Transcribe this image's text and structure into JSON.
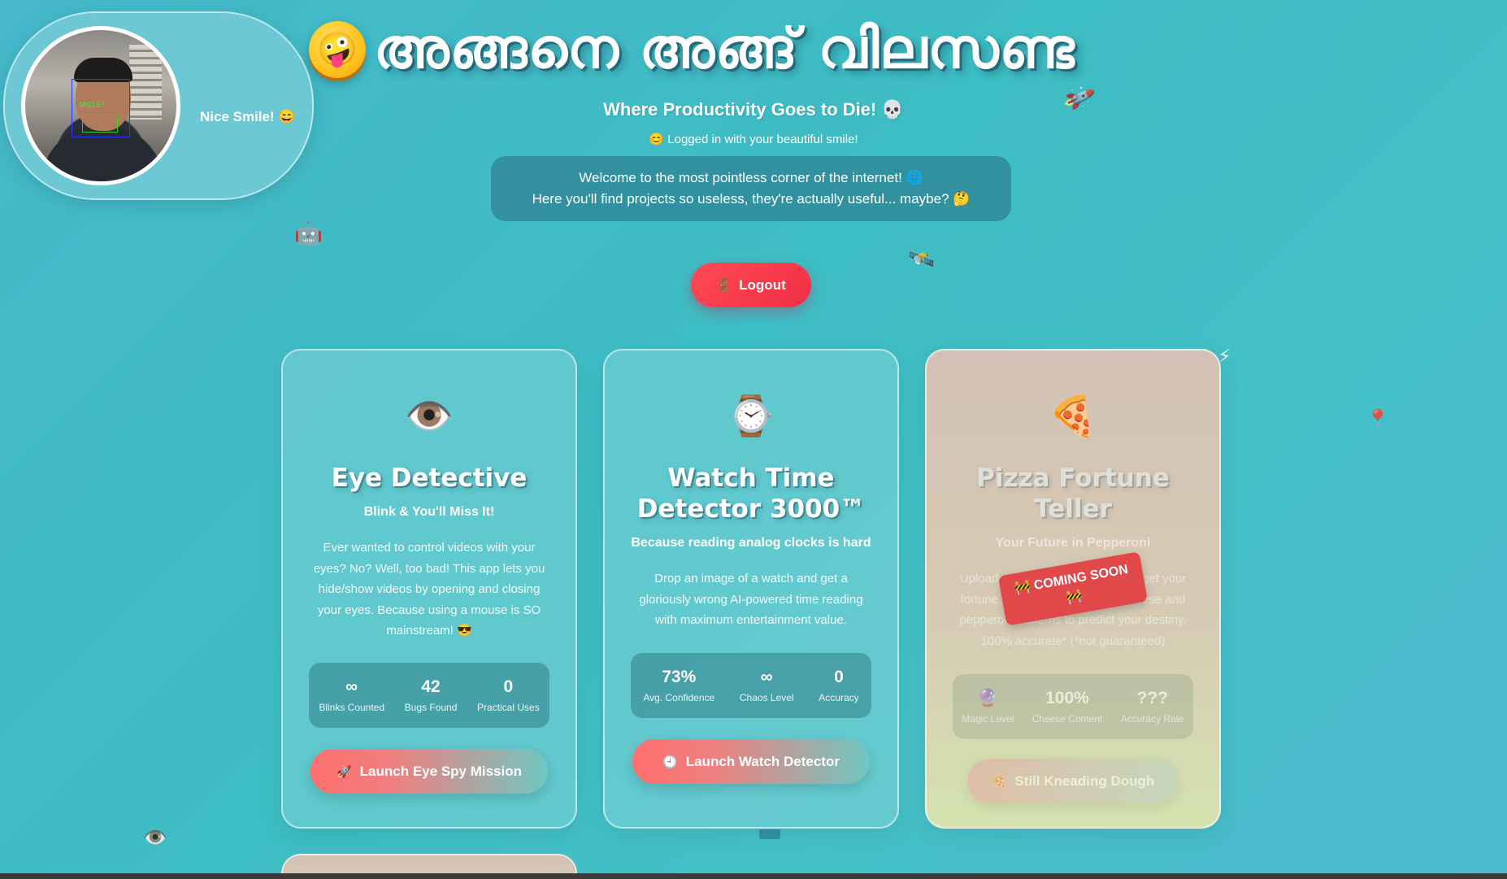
{
  "webcam": {
    "status_text": "Nice Smile! 😄",
    "overlay_label": "SMILE!"
  },
  "header": {
    "emoji": "🤪",
    "title": "അങ്ങനെ അങ്ങ് വിലസണ്ട",
    "subtitle": "Where Productivity Goes to Die! 💀",
    "login_note": "😊 Logged in with your beautiful smile!",
    "welcome_line1": "Welcome to the most pointless corner of the internet! 🌐",
    "welcome_line2": "Here you'll find projects so useless, they're actually useful... maybe? 🤔",
    "logout_icon": "🚪",
    "logout_label": "Logout"
  },
  "decorations": {
    "rocket": "🚀",
    "robot": "🤖",
    "satellite": "🛰️",
    "lightning": "⚡",
    "pins": "📍",
    "eye": "👁️"
  },
  "cards": [
    {
      "icon": "👁️",
      "title": "Eye Detective",
      "tagline": "Blink & You'll Miss It!",
      "description": "Ever wanted to control videos with your eyes? No? Well, too bad! This app lets you hide/show videos by opening and closing your eyes. Because using a mouse is SO mainstream! 😎",
      "stats": [
        {
          "value": "∞",
          "label": "Blinks Counted"
        },
        {
          "value": "42",
          "label": "Bugs Found"
        },
        {
          "value": "0",
          "label": "Practical Uses"
        }
      ],
      "button_icon": "🚀",
      "button_label": "Launch Eye Spy Mission"
    },
    {
      "icon": "⌚",
      "title": "Watch Time Detector 3000™",
      "tagline": "Because reading analog clocks is hard",
      "description": "Drop an image of a watch and get a gloriously wrong AI-powered time reading with maximum entertainment value.",
      "stats": [
        {
          "value": "73%",
          "label": "Avg. Confidence"
        },
        {
          "value": "∞",
          "label": "Chaos Level"
        },
        {
          "value": "0",
          "label": "Accuracy"
        }
      ],
      "button_icon": "🕘",
      "button_label": "Launch Watch Detector"
    },
    {
      "icon": "🍕",
      "title": "Pizza Fortune Teller",
      "tagline": "Your Future in Pepperoni",
      "description": "Upload a photo of your pizza and get your fortune read! Our AI analyzes cheese and pepperoni patterns to predict your destiny. 100% accurate* (*not guaranteed)",
      "badge": "🚧 COMING SOON 🚧",
      "stats": [
        {
          "value": "🔮",
          "label": "Magic Level"
        },
        {
          "value": "100%",
          "label": "Cheese Content"
        },
        {
          "value": "???",
          "label": "Accuracy Rate"
        }
      ],
      "button_icon": "🍕",
      "button_label": "Still Kneading Dough"
    }
  ]
}
